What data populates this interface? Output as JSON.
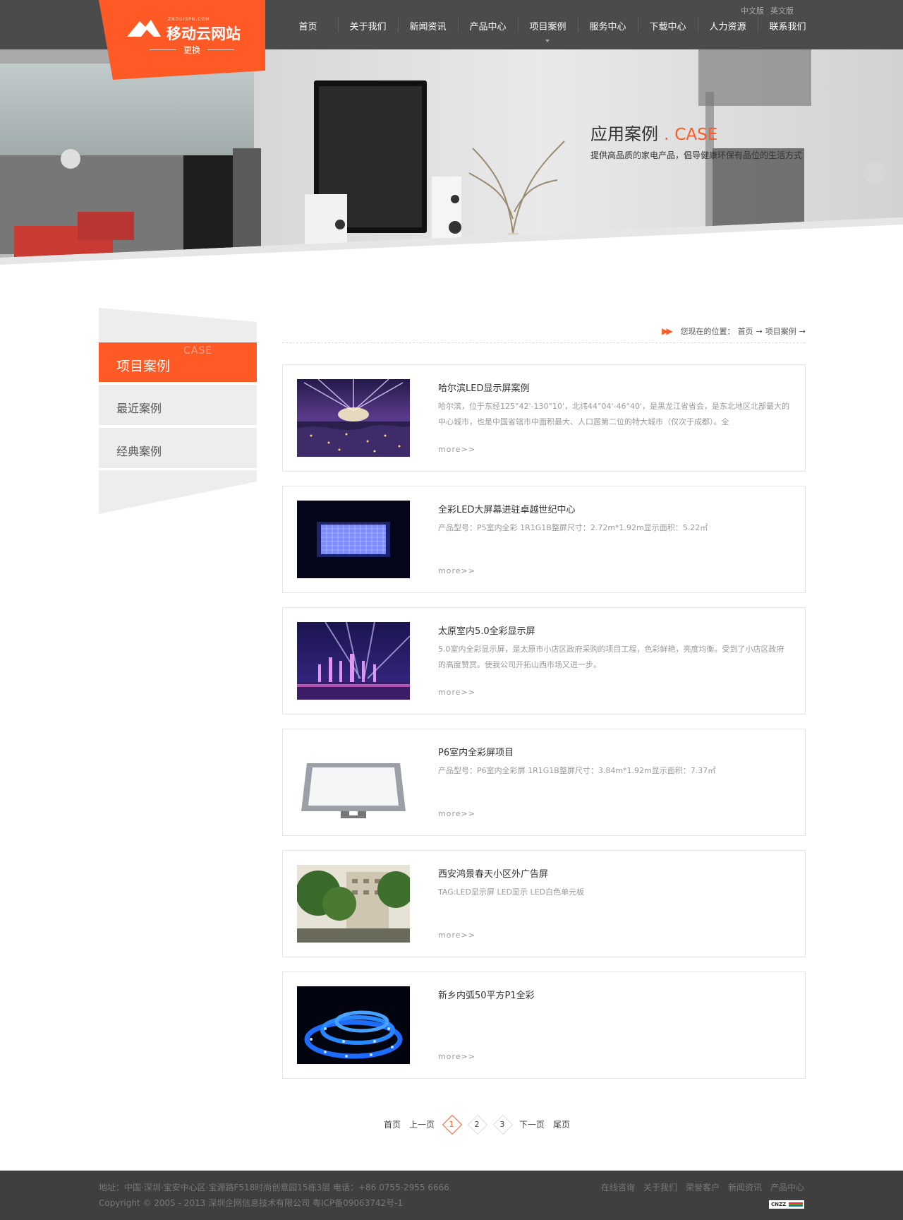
{
  "header": {
    "logo_small": "ZNDUISPN.COM",
    "logo_text": "移动云网站",
    "logo_sub": "更换",
    "lang": [
      "中文版",
      "英文版"
    ],
    "nav": [
      "首页",
      "关于我们",
      "新闻资讯",
      "产品中心",
      "项目案例",
      "服务中心",
      "下载中心",
      "人力资源",
      "联系我们"
    ],
    "active_nav": "项目案例"
  },
  "banner": {
    "title": "应用案例",
    "dot": ".",
    "title_en": "CASE",
    "subtitle": "提供高品质的家电产品，倡导健康环保有品位的生活方式"
  },
  "sidebar": {
    "head_en": "CASE",
    "head_title": "项目案例",
    "items": [
      "最近案例",
      "经典案例"
    ]
  },
  "breadcrumb": {
    "label": "您现在的位置：",
    "home": "首页",
    "sep": "→",
    "current": "项目案例"
  },
  "items": [
    {
      "title": "哈尔滨LED显示屏案例",
      "desc": "哈尔滨，位于东经125°42'-130°10'，北纬44°04'-46°40'，是黑龙江省省会，是东北地区北部最大的中心城市，也是中国省辖市中面积最大、人口居第二位的特大城市（仅次于成都）。全",
      "more": "more>>",
      "thumb": "night-city-lights"
    },
    {
      "title": "全彩LED大屏幕进驻卓越世纪中心",
      "desc": "产品型号：P5室内全彩 1R1G1B整屏尺寸：2.72m*1.92m显示面积：5.22㎡",
      "more": "more>>",
      "thumb": "led-panel-blue"
    },
    {
      "title": "太原室内5.0全彩显示屏",
      "desc": "5.0室内全彩显示屏，是太原市小店区政府采购的项目工程，色彩鲜艳，亮度均衡。受到了小店区政府的高度赞赏。使我公司开拓山西市场又进一步。",
      "more": "more>>",
      "thumb": "fountain-show"
    },
    {
      "title": "P6室内全彩屏项目",
      "desc": "产品型号：P6室内全彩屏 1R1G1B整屏尺寸：3.84m*1.92m显示面积：7.37㎡",
      "more": "more>>",
      "thumb": "monitor-frame"
    },
    {
      "title": "西安鸿景春天小区外广告屏",
      "desc": "TAG:LED显示屏   LED显示   LED白色单元板",
      "more": "more>>",
      "thumb": "trees-building"
    },
    {
      "title": "新乡内弧50平方P1全彩",
      "desc": "",
      "more": "more>>",
      "thumb": "led-strip-blue"
    }
  ],
  "pager": {
    "first": "首页",
    "prev": "上一页",
    "pages": [
      "1",
      "2",
      "3"
    ],
    "current": "1",
    "next": "下一页",
    "last": "尾页"
  },
  "footer": {
    "address": "地址：中国·深圳·宝安中心区·宝源路F518时尚创意园15栋3层 电话：+86 0755-2955 6666",
    "copyright": "Copyright © 2005 - 2013 深圳企网信息技术有限公司 粤ICP备09063742号-1",
    "links": [
      "在线咨询",
      "关于我们",
      "荣誉客户",
      "新闻资讯",
      "产品中心"
    ],
    "stat_badge": "CNZZ"
  },
  "colors": {
    "accent": "#ff5a26",
    "topbar": "#4b4b4b",
    "footer": "#3f3f3f"
  }
}
